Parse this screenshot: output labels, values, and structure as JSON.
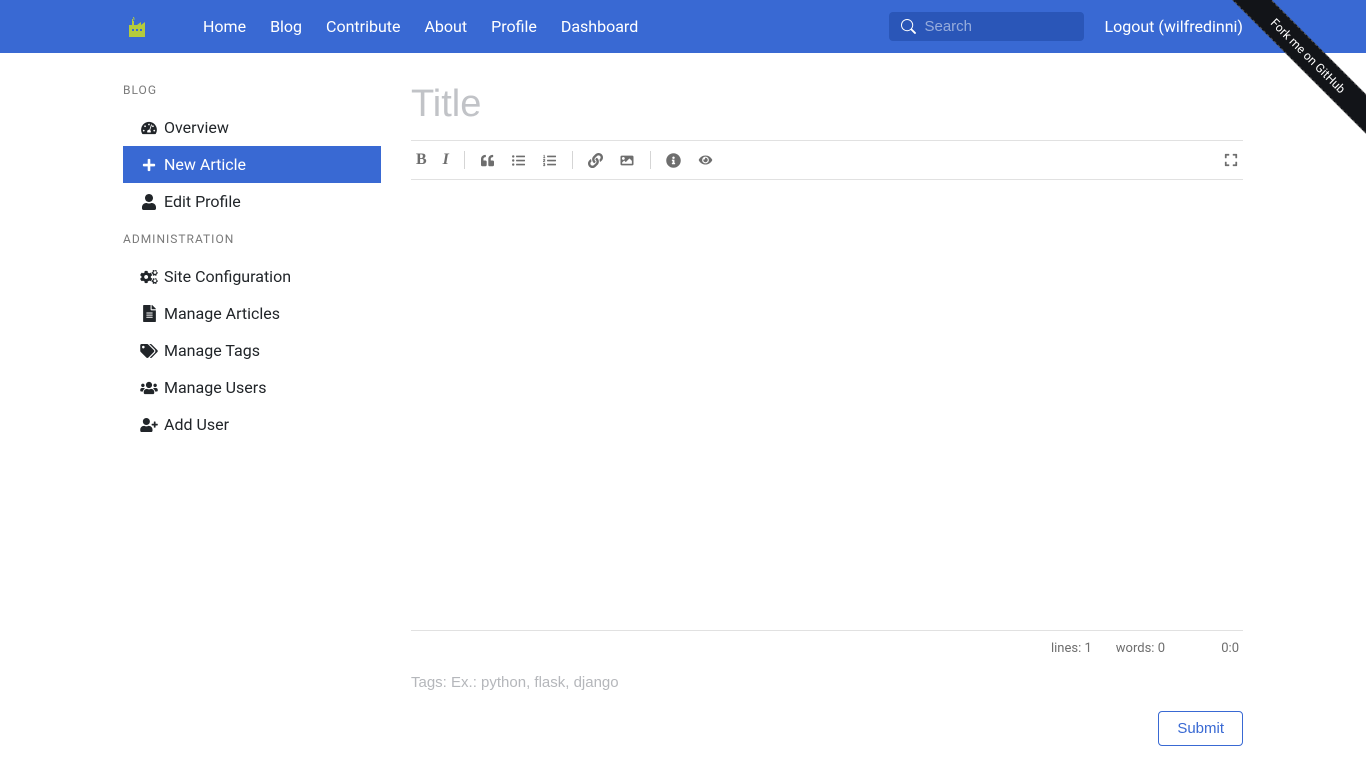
{
  "nav": {
    "items": [
      "Home",
      "Blog",
      "Contribute",
      "About",
      "Profile",
      "Dashboard"
    ],
    "search_placeholder": "Search",
    "logout": "Logout (wilfredinni)"
  },
  "fork_ribbon": "Fork me on GitHub",
  "sidebar": {
    "heading_blog": "BLOG",
    "heading_admin": "ADMINISTRATION",
    "blog_items": [
      {
        "label": "Overview",
        "icon": "dashboard-icon",
        "active": false
      },
      {
        "label": "New Article",
        "icon": "plus-icon",
        "active": true
      },
      {
        "label": "Edit Profile",
        "icon": "user-icon",
        "active": false
      }
    ],
    "admin_items": [
      {
        "label": "Site Configuration",
        "icon": "cogs-icon"
      },
      {
        "label": "Manage Articles",
        "icon": "file-icon"
      },
      {
        "label": "Manage Tags",
        "icon": "tags-icon"
      },
      {
        "label": "Manage Users",
        "icon": "users-icon"
      },
      {
        "label": "Add User",
        "icon": "user-plus-icon"
      }
    ]
  },
  "editor": {
    "title_placeholder": "Title",
    "tags_placeholder": "Tags: Ex.: python, flask, django",
    "status_lines_label": "lines:",
    "status_lines_value": "1",
    "status_words_label": "words:",
    "status_words_value": "0",
    "cursor_pos": "0:0",
    "submit_label": "Submit"
  }
}
